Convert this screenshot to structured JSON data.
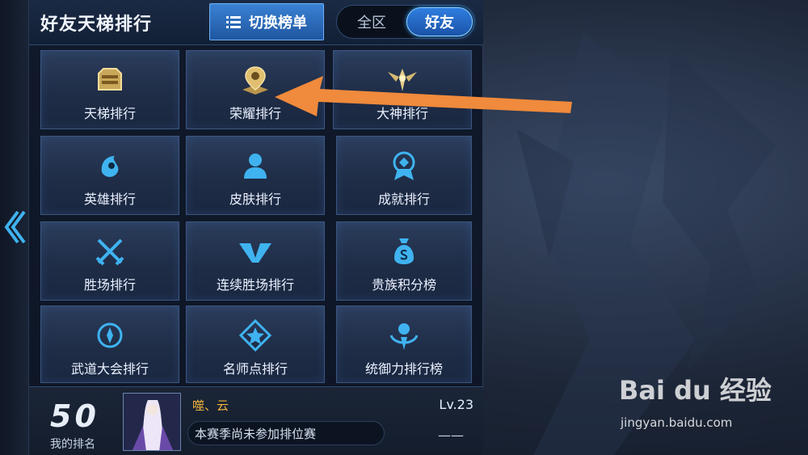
{
  "header": {
    "title": "好友天梯排行",
    "switch_label": "切换榜单",
    "segments": [
      {
        "label": "全区",
        "active": false
      },
      {
        "label": "好友",
        "active": true
      }
    ]
  },
  "categories": [
    {
      "label": "天梯排行",
      "icon": "ladder-crown-icon",
      "color": "#e8c87a"
    },
    {
      "label": "荣耀排行",
      "icon": "location-pin-icon",
      "color": "#e2c27a"
    },
    {
      "label": "大神排行",
      "icon": "winged-emblem-icon",
      "color": "#e4cc88"
    },
    {
      "label": "英雄排行",
      "icon": "hero-helmet-icon",
      "color": "#43b8f0"
    },
    {
      "label": "皮肤排行",
      "icon": "user-silhouette-icon",
      "color": "#43b8f0"
    },
    {
      "label": "成就排行",
      "icon": "achievement-badge-icon",
      "color": "#43b8f0"
    },
    {
      "label": "胜场排行",
      "icon": "crossed-swords-icon",
      "color": "#43b8f0"
    },
    {
      "label": "连续胜场排行",
      "icon": "wing-v-icon",
      "color": "#43b8f0"
    },
    {
      "label": "贵族积分榜",
      "icon": "money-bag-icon",
      "color": "#43b8f0"
    },
    {
      "label": "武道大会排行",
      "icon": "compass-medal-icon",
      "color": "#43b8f0"
    },
    {
      "label": "名师点排行",
      "icon": "mentor-star-icon",
      "color": "#43b8f0"
    },
    {
      "label": "统御力排行榜",
      "icon": "command-crest-icon",
      "color": "#43b8f0"
    }
  ],
  "my_rank": {
    "rank": "50",
    "rank_label": "我的排名",
    "player_name": "噬、云",
    "level": "Lv.23",
    "status": "本赛季尚未参加排位赛",
    "score": "——"
  },
  "watermark": {
    "main": "Bai du 经验",
    "sub": "jingyan.baidu.com"
  },
  "colors": {
    "accent": "#2f7ee0",
    "gold_name": "#f0b43c",
    "arrow": "#f08a3c"
  }
}
